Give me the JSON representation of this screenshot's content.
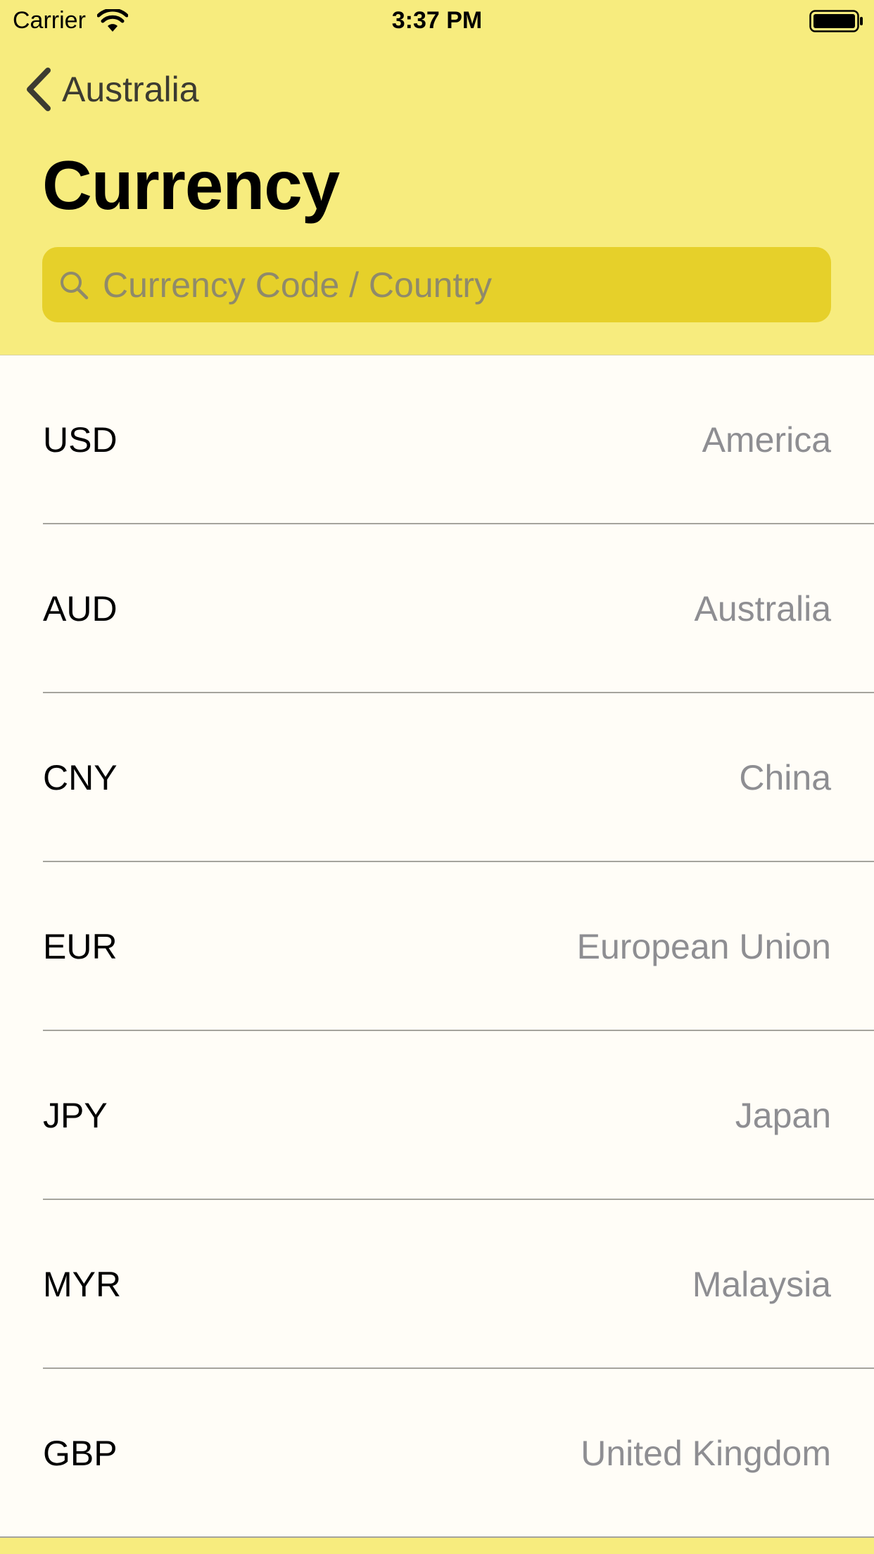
{
  "status_bar": {
    "carrier": "Carrier",
    "time": "3:37 PM"
  },
  "navigation": {
    "back_label": "Australia",
    "title": "Currency"
  },
  "search": {
    "placeholder": "Currency Code / Country",
    "value": ""
  },
  "currencies": [
    {
      "code": "USD",
      "country": "America"
    },
    {
      "code": "AUD",
      "country": "Australia"
    },
    {
      "code": "CNY",
      "country": "China"
    },
    {
      "code": "EUR",
      "country": "European Union"
    },
    {
      "code": "JPY",
      "country": "Japan"
    },
    {
      "code": "MYR",
      "country": "Malaysia"
    },
    {
      "code": "GBP",
      "country": "United Kingdom"
    }
  ],
  "colors": {
    "header_background": "#f7ec7e",
    "search_background": "#e6d02a",
    "list_background": "#fffdf7",
    "secondary_text": "#8e8e92"
  },
  "icons": [
    "wifi-icon",
    "battery-icon",
    "chevron-left-icon",
    "search-icon"
  ]
}
